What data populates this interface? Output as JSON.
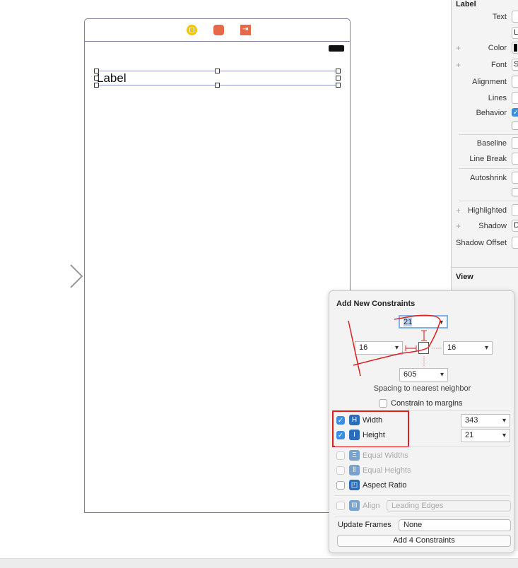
{
  "canvas": {
    "label_text": "Label",
    "scene_icons": [
      "view-controller-icon",
      "first-responder-icon",
      "exit-icon"
    ]
  },
  "inspector": {
    "section_label": "Label",
    "section_view": "View",
    "rows": [
      {
        "label": "Text",
        "value": ""
      },
      {
        "label": "",
        "value": "L"
      },
      {
        "label": "Color",
        "value": ""
      },
      {
        "label": "Font",
        "value": "S"
      },
      {
        "label": "Alignment",
        "value": ""
      },
      {
        "label": "Lines",
        "value": ""
      },
      {
        "label": "Behavior",
        "value": ""
      },
      {
        "label": "Baseline",
        "value": ""
      },
      {
        "label": "Line Break",
        "value": ""
      },
      {
        "label": "Autoshrink",
        "value": ""
      },
      {
        "label": "Highlighted",
        "value": ""
      },
      {
        "label": "Shadow",
        "value": "D"
      },
      {
        "label": "Shadow Offset",
        "value": ""
      }
    ]
  },
  "popover": {
    "title": "Add New Constraints",
    "top": "21",
    "left": "16",
    "right": "16",
    "bottom": "605",
    "spacing_caption": "Spacing to nearest neighbor",
    "constrain_margins": {
      "label": "Constrain to margins",
      "checked": false
    },
    "width": {
      "label": "Width",
      "checked": true,
      "value": "343"
    },
    "height": {
      "label": "Height",
      "checked": true,
      "value": "21"
    },
    "equal_widths": {
      "label": "Equal Widths",
      "enabled": false
    },
    "equal_heights": {
      "label": "Equal Heights",
      "enabled": false
    },
    "aspect_ratio": {
      "label": "Aspect Ratio",
      "checked": false
    },
    "align": {
      "label": "Align",
      "value": "Leading Edges",
      "enabled": false
    },
    "update_frames": {
      "label": "Update Frames",
      "value": "None"
    },
    "add_button": "Add 4 Constraints",
    "annotation_color": "#e02020"
  }
}
